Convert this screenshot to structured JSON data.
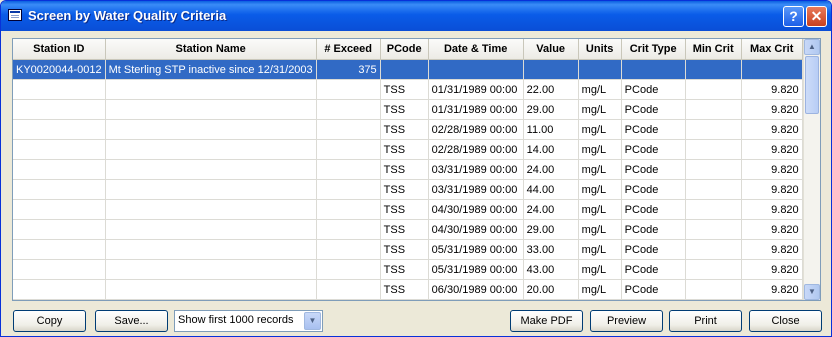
{
  "window": {
    "title": "Screen by Water Quality Criteria",
    "help_glyph": "?",
    "close_glyph": "✕"
  },
  "table": {
    "columns": [
      "Station ID",
      "Station Name",
      "# Exceed",
      "PCode",
      "Date & Time",
      "Value",
      "Units",
      "Crit Type",
      "Min Crit",
      "Max Crit"
    ],
    "rows": [
      {
        "selected": true,
        "cells": [
          "KY0020044-0012",
          "Mt Sterling STP inactive since 12/31/2003",
          "375",
          "",
          "",
          "",
          "",
          "",
          "",
          ""
        ]
      },
      {
        "selected": false,
        "cells": [
          "",
          "",
          "",
          "TSS",
          "01/31/1989 00:00",
          "22.00",
          "mg/L",
          "PCode",
          "",
          "9.820"
        ]
      },
      {
        "selected": false,
        "cells": [
          "",
          "",
          "",
          "TSS",
          "01/31/1989 00:00",
          "29.00",
          "mg/L",
          "PCode",
          "",
          "9.820"
        ]
      },
      {
        "selected": false,
        "cells": [
          "",
          "",
          "",
          "TSS",
          "02/28/1989 00:00",
          "11.00",
          "mg/L",
          "PCode",
          "",
          "9.820"
        ]
      },
      {
        "selected": false,
        "cells": [
          "",
          "",
          "",
          "TSS",
          "02/28/1989 00:00",
          "14.00",
          "mg/L",
          "PCode",
          "",
          "9.820"
        ]
      },
      {
        "selected": false,
        "cells": [
          "",
          "",
          "",
          "TSS",
          "03/31/1989 00:00",
          "24.00",
          "mg/L",
          "PCode",
          "",
          "9.820"
        ]
      },
      {
        "selected": false,
        "cells": [
          "",
          "",
          "",
          "TSS",
          "03/31/1989 00:00",
          "44.00",
          "mg/L",
          "PCode",
          "",
          "9.820"
        ]
      },
      {
        "selected": false,
        "cells": [
          "",
          "",
          "",
          "TSS",
          "04/30/1989 00:00",
          "24.00",
          "mg/L",
          "PCode",
          "",
          "9.820"
        ]
      },
      {
        "selected": false,
        "cells": [
          "",
          "",
          "",
          "TSS",
          "04/30/1989 00:00",
          "29.00",
          "mg/L",
          "PCode",
          "",
          "9.820"
        ]
      },
      {
        "selected": false,
        "cells": [
          "",
          "",
          "",
          "TSS",
          "05/31/1989 00:00",
          "33.00",
          "mg/L",
          "PCode",
          "",
          "9.820"
        ]
      },
      {
        "selected": false,
        "cells": [
          "",
          "",
          "",
          "TSS",
          "05/31/1989 00:00",
          "43.00",
          "mg/L",
          "PCode",
          "",
          "9.820"
        ]
      },
      {
        "selected": false,
        "cells": [
          "",
          "",
          "",
          "TSS",
          "06/30/1989 00:00",
          "20.00",
          "mg/L",
          "PCode",
          "",
          "9.820"
        ]
      },
      {
        "selected": false,
        "cells": [
          "",
          "",
          "",
          "",
          "",
          "",
          "",
          "",
          "",
          ""
        ]
      }
    ]
  },
  "footer": {
    "copy_label": "Copy",
    "save_label": "Save...",
    "records_select": {
      "value": "Show first 1000 records"
    },
    "make_pdf_label": "Make PDF",
    "preview_label": "Preview",
    "print_label": "Print",
    "close_label": "Close"
  }
}
